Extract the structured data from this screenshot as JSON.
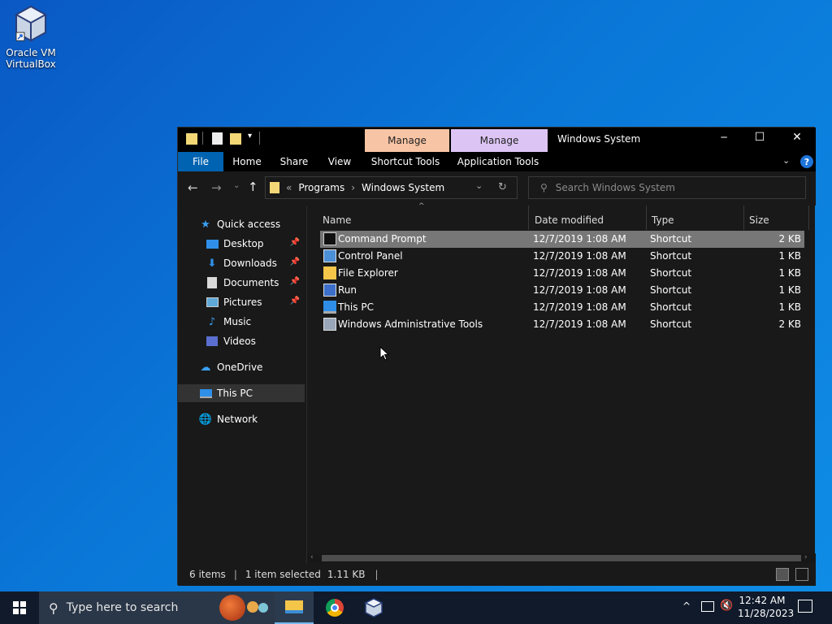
{
  "desktop": {
    "icon_label": "Oracle VM VirtualBox"
  },
  "window": {
    "title": "Windows System",
    "manage_1": "Manage",
    "manage_2": "Manage",
    "controls": {
      "minimize": "─",
      "maximize": "☐",
      "close": "✕"
    }
  },
  "ribbon": {
    "tabs": [
      "File",
      "Home",
      "Share",
      "View",
      "Shortcut Tools",
      "Application Tools"
    ]
  },
  "address": {
    "overflow": "«",
    "crumbs": [
      "Programs",
      "Windows System"
    ],
    "search_placeholder": "Search Windows System"
  },
  "nav": {
    "quick_access": "Quick access",
    "items": [
      "Desktop",
      "Downloads",
      "Documents",
      "Pictures",
      "Music",
      "Videos"
    ],
    "onedrive": "OneDrive",
    "this_pc": "This PC",
    "network": "Network"
  },
  "columns": {
    "name": "Name",
    "date": "Date modified",
    "type": "Type",
    "size": "Size"
  },
  "files": [
    {
      "name": "Command Prompt",
      "date": "12/7/2019 1:08 AM",
      "type": "Shortcut",
      "size": "2 KB"
    },
    {
      "name": "Control Panel",
      "date": "12/7/2019 1:08 AM",
      "type": "Shortcut",
      "size": "1 KB"
    },
    {
      "name": "File Explorer",
      "date": "12/7/2019 1:08 AM",
      "type": "Shortcut",
      "size": "1 KB"
    },
    {
      "name": "Run",
      "date": "12/7/2019 1:08 AM",
      "type": "Shortcut",
      "size": "1 KB"
    },
    {
      "name": "This PC",
      "date": "12/7/2019 1:08 AM",
      "type": "Shortcut",
      "size": "1 KB"
    },
    {
      "name": "Windows Administrative Tools",
      "date": "12/7/2019 1:08 AM",
      "type": "Shortcut",
      "size": "2 KB"
    }
  ],
  "status": {
    "count": "6 items",
    "selected": "1 item selected",
    "sel_size": "1.11 KB"
  },
  "taskbar": {
    "search_placeholder": "Type here to search",
    "time": "12:42 AM",
    "date": "11/28/2023"
  },
  "colors": {
    "accent": "#0063b1",
    "manage_shortcut": "#f7c4a5",
    "manage_app": "#dcc5f4",
    "selected_row": "#777777"
  }
}
